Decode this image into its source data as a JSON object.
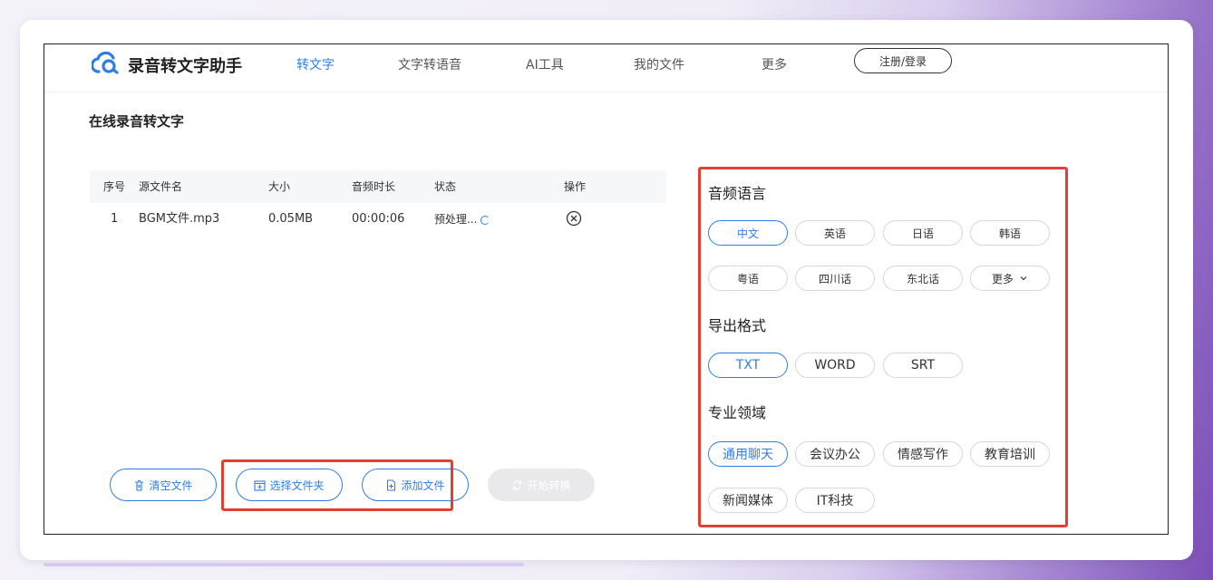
{
  "header": {
    "brand": "录音转文字助手",
    "nav": [
      "转文字",
      "文字转语音",
      "AI工具",
      "我的文件",
      "更多"
    ],
    "login": "注册/登录"
  },
  "page_title": "在线录音转文字",
  "table": {
    "headers": [
      "序号",
      "源文件名",
      "大小",
      "音频时长",
      "状态",
      "操作"
    ],
    "rows": [
      {
        "index": "1",
        "name": "BGM文件.mp3",
        "size": "0.05MB",
        "duration": "00:00:06",
        "status": "预处理..."
      }
    ]
  },
  "buttons": {
    "clear": "清空文件",
    "select_folder": "选择文件夹",
    "add_file": "添加文件",
    "start": "开始转换"
  },
  "settings": {
    "language_title": "音频语言",
    "languages": [
      "中文",
      "英语",
      "日语",
      "韩语",
      "粤语",
      "四川话",
      "东北话",
      "更多"
    ],
    "format_title": "导出格式",
    "formats": [
      "TXT",
      "WORD",
      "SRT"
    ],
    "domain_title": "专业领域",
    "domains": [
      "通用聊天",
      "会议办公",
      "情感写作",
      "教育培训",
      "新闻媒体",
      "IT科技"
    ],
    "selected": {
      "language": "中文",
      "format": "TXT",
      "domain": "通用聊天"
    }
  },
  "colors": {
    "accent": "#2f7ee8",
    "highlight": "#e14132"
  }
}
